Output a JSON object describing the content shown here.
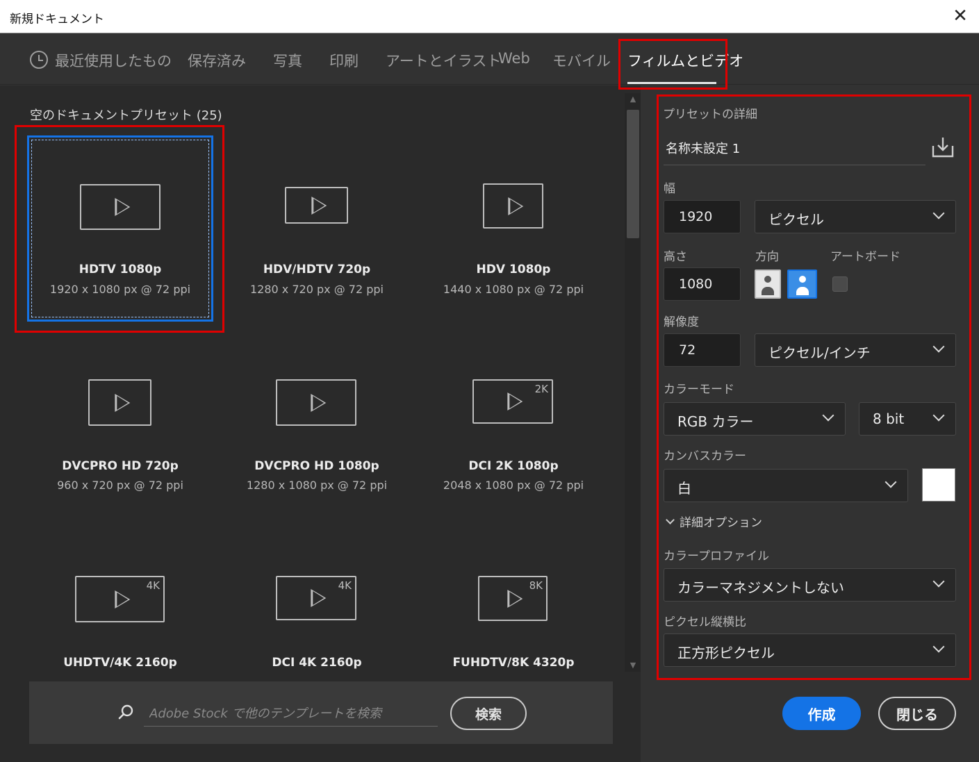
{
  "window": {
    "title": "新規ドキュメント",
    "close_glyph": "✕"
  },
  "tabs": [
    {
      "label": "最近使用したもの"
    },
    {
      "label": "保存済み"
    },
    {
      "label": "写真"
    },
    {
      "label": "印刷"
    },
    {
      "label": "アートとイラスト"
    },
    {
      "label": "Web"
    },
    {
      "label": "モバイル"
    },
    {
      "label": "フィルムとビデオ"
    }
  ],
  "active_tab": "フィルムとビデオ",
  "presets_label": "空のドキュメントプリセット (25)",
  "presets": [
    {
      "name": "HDTV 1080p",
      "spec": "1920 x 1080 px @ 72 ppi",
      "badge": "",
      "selected": true
    },
    {
      "name": "HDV/HDTV 720p",
      "spec": "1280 x 720 px @ 72 ppi",
      "badge": ""
    },
    {
      "name": "HDV 1080p",
      "spec": "1440 x 1080 px @ 72 ppi",
      "badge": ""
    },
    {
      "name": "DVCPRO HD 720p",
      "spec": "960 x 720 px @ 72 ppi",
      "badge": ""
    },
    {
      "name": "DVCPRO HD 1080p",
      "spec": "1280 x 1080 px @ 72 ppi",
      "badge": ""
    },
    {
      "name": "DCI 2K 1080p",
      "spec": "2048 x 1080 px @ 72 ppi",
      "badge": "2K"
    },
    {
      "name": "UHDTV/4K 2160p",
      "spec": "",
      "badge": "4K"
    },
    {
      "name": "DCI 4K 2160p",
      "spec": "",
      "badge": "4K"
    },
    {
      "name": "FUHDTV/8K 4320p",
      "spec": "",
      "badge": "8K"
    }
  ],
  "search": {
    "placeholder": "Adobe Stock で他のテンプレートを検索",
    "button": "検索"
  },
  "details": {
    "heading": "プリセットの詳細",
    "doc_name": "名称未設定 1",
    "width_label": "幅",
    "width_value": "1920",
    "width_unit": "ピクセル",
    "height_label": "高さ",
    "height_value": "1080",
    "orientation_label": "方向",
    "artboard_label": "アートボード",
    "resolution_label": "解像度",
    "resolution_value": "72",
    "resolution_unit": "ピクセル/インチ",
    "color_mode_label": "カラーモード",
    "color_mode": "RGB カラー",
    "bit_depth": "8 bit",
    "canvas_color_label": "カンバスカラー",
    "canvas_color": "白",
    "canvas_swatch": "#ffffff",
    "advanced_label": "詳細オプション",
    "color_profile_label": "カラープロファイル",
    "color_profile": "カラーマネジメントしない",
    "pixel_aspect_label": "ピクセル縦横比",
    "pixel_aspect": "正方形ピクセル"
  },
  "actions": {
    "create": "作成",
    "close": "閉じる"
  },
  "colors": {
    "accent": "#1473e6",
    "highlight": "#e00000",
    "panel": "#2a2a2a"
  }
}
